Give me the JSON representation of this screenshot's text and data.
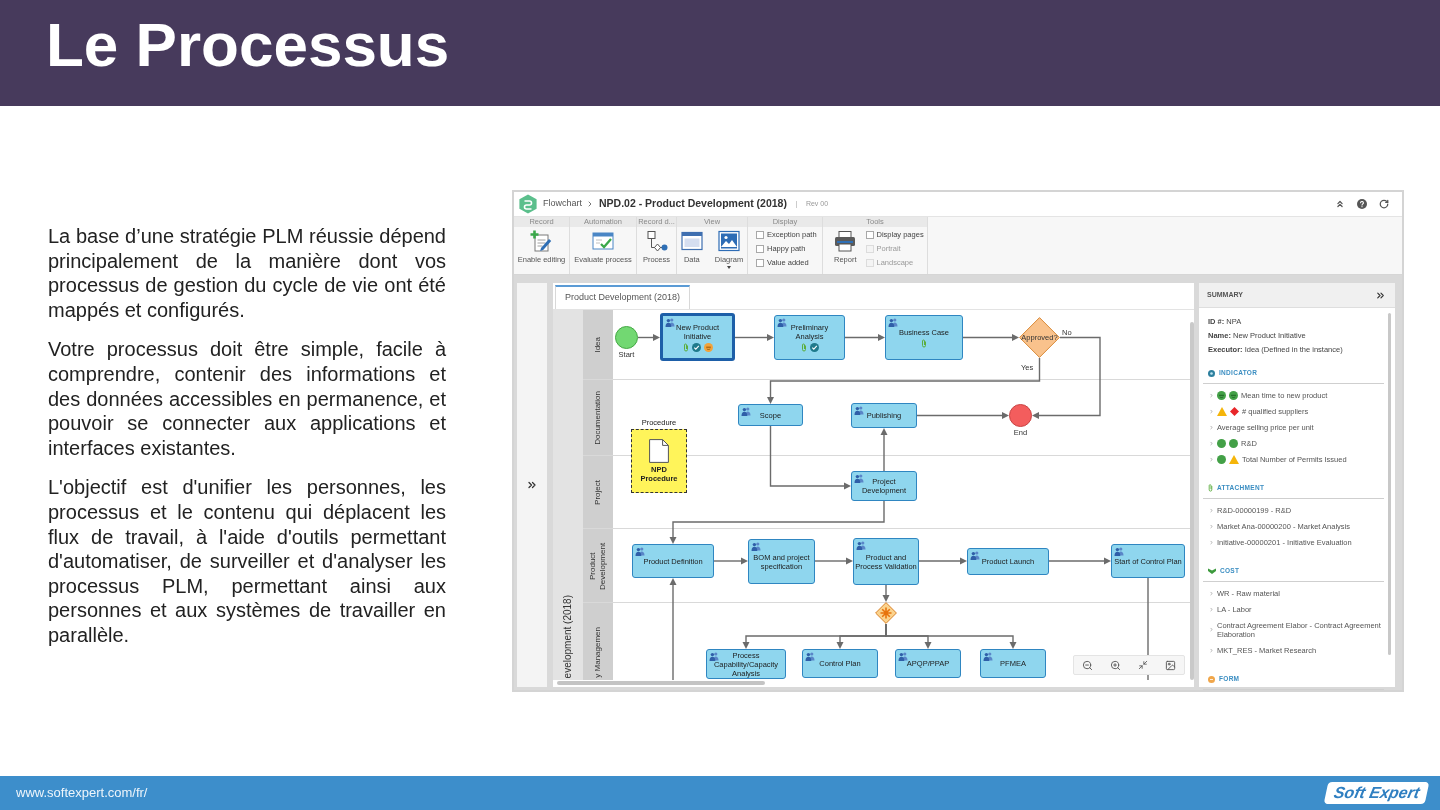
{
  "header": {
    "title": "Le Processus"
  },
  "intro": {
    "paragraphs": [
      "La base d’une stratégie PLM réussie dépend principalement de la manière dont vos processus de gestion du cycle de vie ont été mappés et configurés.",
      "Votre processus doit être simple, facile à comprendre, contenir des informations et des données accessibles en permanence, et pouvoir se connecter aux applications et interfaces existantes.",
      "L'objectif est d'unifier les personnes, les processus et le contenu qui déplacent les flux de travail, à l'aide d'outils permettant d'automatiser, de surveiller et d'analyser les processus PLM, permettant ainsi aux personnes et aux systèmes de travailler en parallèle."
    ]
  },
  "app": {
    "title_bar": {
      "module": "Flowchart",
      "document": "NPD.02 - Product Development (2018)",
      "revision": "Rev 00"
    },
    "ribbon": {
      "groups": [
        {
          "label": "Record",
          "items": [
            {
              "kind": "button",
              "label": "Enable editing",
              "dropdown": false
            }
          ]
        },
        {
          "label": "Automation",
          "items": [
            {
              "kind": "button",
              "label": "Evaluate process",
              "dropdown": false
            }
          ]
        },
        {
          "label": "Record d...",
          "items": [
            {
              "kind": "button",
              "label": "Process",
              "dropdown": false
            }
          ]
        },
        {
          "label": "View",
          "items": [
            {
              "kind": "button",
              "label": "Data",
              "dropdown": false
            },
            {
              "kind": "button",
              "label": "Diagram",
              "dropdown": true
            }
          ]
        },
        {
          "label": "Display",
          "items": [
            {
              "kind": "checkbox",
              "label": "Exception path",
              "checked": false,
              "disabled": false
            },
            {
              "kind": "checkbox",
              "label": "Happy path",
              "checked": false,
              "disabled": false
            },
            {
              "kind": "checkbox",
              "label": "Value added",
              "checked": false,
              "disabled": false
            }
          ]
        },
        {
          "label": "Tools",
          "items": [
            {
              "kind": "button",
              "label": "Report",
              "dropdown": false
            },
            {
              "kind": "checkbox",
              "label": "Display pages",
              "checked": false,
              "disabled": false
            },
            {
              "kind": "checkbox",
              "label": "Portrait",
              "checked": false,
              "disabled": true
            },
            {
              "kind": "checkbox",
              "label": "Landscape",
              "checked": false,
              "disabled": true
            }
          ]
        }
      ]
    },
    "canvas": {
      "tabs": [
        {
          "label": "Product Development (2018)",
          "selected": true
        }
      ],
      "diagram": {
        "pool": "evelopment (2018)",
        "lanes": [
          {
            "label": "Idea"
          },
          {
            "label": "Documentation"
          },
          {
            "label": "Project"
          },
          {
            "label": "Product Development"
          },
          {
            "label": "y Managemen"
          }
        ],
        "nodes": [
          {
            "kind": "start",
            "label": "Start",
            "selected": false
          },
          {
            "kind": "task",
            "label": "New Product Initiative",
            "selected": true,
            "badges": [
              {
                "kind": "attachment"
              },
              {
                "kind": "check"
              },
              {
                "kind": "face"
              }
            ]
          },
          {
            "kind": "task",
            "label": "Preliminary Analysis",
            "selected": false,
            "badges": [
              {
                "kind": "attachment"
              },
              {
                "kind": "check"
              }
            ]
          },
          {
            "kind": "task",
            "label": "Business Case",
            "selected": false,
            "badges": [
              {
                "kind": "attachment"
              }
            ]
          },
          {
            "kind": "decision",
            "label": "Approved?",
            "selected": false,
            "branches": [
              "No",
              "Yes"
            ]
          },
          {
            "kind": "task",
            "label": "Scope",
            "selected": false
          },
          {
            "kind": "task",
            "label": "Publishing",
            "selected": false
          },
          {
            "kind": "end",
            "label": "End",
            "selected": false
          },
          {
            "kind": "document",
            "title": "Procedure",
            "label": "NPD Procedure",
            "selected": false
          },
          {
            "kind": "task",
            "label": "Project Development",
            "selected": false
          },
          {
            "kind": "task",
            "label": "Product Definition",
            "selected": false
          },
          {
            "kind": "task",
            "label": "BOM and project specification",
            "selected": false
          },
          {
            "kind": "task",
            "label": "Product and Process Validation",
            "selected": false
          },
          {
            "kind": "task",
            "label": "Product Launch",
            "selected": false
          },
          {
            "kind": "task",
            "label": "Start of Control Plan",
            "selected": false
          },
          {
            "kind": "parallel",
            "selected": false
          },
          {
            "kind": "task",
            "label": "Process Capability/Capacity Analysis",
            "selected": false
          },
          {
            "kind": "task",
            "label": "Control Plan",
            "selected": false
          },
          {
            "kind": "task",
            "label": "APQP/PPAP",
            "selected": false
          },
          {
            "kind": "task",
            "label": "PFMEA",
            "selected": false
          }
        ]
      }
    },
    "summary": {
      "title": "SUMMARY",
      "fields": [
        "**ID #:** NPA",
        "**Name:** New Product Initiative",
        "**Executor:** Idea (Defined in the instance)"
      ],
      "sections": [
        {
          "kind": "indicator",
          "title": "INDICATOR",
          "items": [
            {
              "text": "Mean time to new product",
              "statuses": [
                {
                  "kind": "face",
                  "color": "#43a047"
                },
                {
                  "kind": "face",
                  "color": "#43a047"
                }
              ]
            },
            {
              "text": "# qualified suppliers",
              "statuses": [
                {
                  "kind": "triangle",
                  "color": "#f5b50a"
                },
                {
                  "kind": "diamond",
                  "color": "#e8262a"
                }
              ]
            },
            {
              "text": "Average selling price per unit"
            },
            {
              "text": "R&D",
              "statuses": [
                {
                  "kind": "dot",
                  "color": "#43a047"
                },
                {
                  "kind": "dot",
                  "color": "#43a047"
                }
              ]
            },
            {
              "text": "Total Number of Permits Issued",
              "statuses": [
                {
                  "kind": "dot",
                  "color": "#43a047"
                },
                {
                  "kind": "triangle",
                  "color": "#f5b50a"
                }
              ]
            }
          ]
        },
        {
          "kind": "attachment",
          "title": "ATTACHMENT",
          "items": [
            {
              "text": "R&D-00000199 - R&D"
            },
            {
              "text": "Market Ana-00000200 - Market Analysis"
            },
            {
              "text": "Initiative-00000201 - Initiative Evaluation"
            }
          ]
        },
        {
          "kind": "cost",
          "title": "COST",
          "items": [
            {
              "text": "WR - Raw material"
            },
            {
              "text": "LA - Labor"
            },
            {
              "text": "Contract Agreement Elabor - Contract Agreement Elaboration"
            },
            {
              "text": "MKT_RES - Market Research"
            }
          ]
        },
        {
          "kind": "form",
          "title": "FORM"
        }
      ]
    }
  },
  "footer": {
    "url": "www.softexpert.com/fr/",
    "logo": "Soft Expert"
  }
}
